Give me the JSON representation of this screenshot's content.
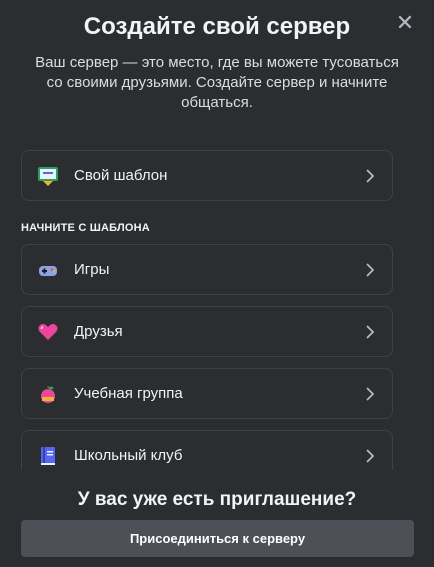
{
  "modal": {
    "title": "Создайте свой сервер",
    "subtitle": "Ваш сервер — это место, где вы можете тусоваться со своими друзьями. Создайте сервер и начните общаться.",
    "close_icon": "close-icon"
  },
  "own_template": {
    "label": "Свой шаблон",
    "icon": "template-icon"
  },
  "section_label": "НАЧНИТЕ С ШАБЛОНА",
  "templates": [
    {
      "label": "Игры",
      "icon": "gamepad-icon"
    },
    {
      "label": "Друзья",
      "icon": "heart-icon"
    },
    {
      "label": "Учебная группа",
      "icon": "apple-icon"
    },
    {
      "label": "Школьный клуб",
      "icon": "book-icon"
    }
  ],
  "footer": {
    "title": "У вас уже есть приглашение?",
    "join_label": "Присоединиться к серверу"
  },
  "colors": {
    "background": "#2b2d31",
    "card_border": "#3f4147",
    "button_bg": "#4e5058",
    "text": "#f2f3f5"
  }
}
